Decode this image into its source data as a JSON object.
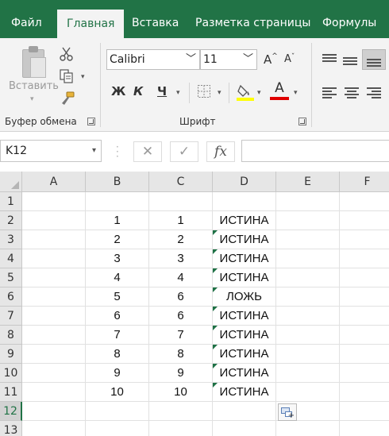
{
  "tabs": [
    {
      "label": "Файл",
      "active": false
    },
    {
      "label": "Главная",
      "active": true
    },
    {
      "label": "Вставка",
      "active": false
    },
    {
      "label": "Разметка страницы",
      "active": false
    },
    {
      "label": "Формулы",
      "active": false
    }
  ],
  "ribbon": {
    "clipboard": {
      "paste_label": "Вставить",
      "group_label": "Буфер обмена"
    },
    "font": {
      "font_name": "Calibri",
      "font_size": "11",
      "bold": "Ж",
      "italic": "К",
      "underline": "Ч",
      "grow": "A",
      "shrink": "A",
      "font_color_letter": "A",
      "group_label": "Шрифт"
    },
    "colors": {
      "accent": "#217346",
      "highlight": "#ffff00",
      "font_color": "#e00000"
    }
  },
  "formula_bar": {
    "name_box": "K12",
    "cancel": "✕",
    "enter": "✓",
    "fx": "fx",
    "value": ""
  },
  "grid": {
    "columns": [
      "A",
      "B",
      "C",
      "D",
      "E",
      "F"
    ],
    "rows": [
      {
        "num": "1",
        "cells": [
          "",
          "",
          "",
          "",
          "",
          ""
        ],
        "flag": false
      },
      {
        "num": "2",
        "cells": [
          "",
          "1",
          "1",
          "ИСТИНА",
          "",
          ""
        ],
        "flag": false
      },
      {
        "num": "3",
        "cells": [
          "",
          "2",
          "2",
          "ИСТИНА",
          "",
          ""
        ],
        "flag": true
      },
      {
        "num": "4",
        "cells": [
          "",
          "3",
          "3",
          "ИСТИНА",
          "",
          ""
        ],
        "flag": true
      },
      {
        "num": "5",
        "cells": [
          "",
          "4",
          "4",
          "ИСТИНА",
          "",
          ""
        ],
        "flag": true
      },
      {
        "num": "6",
        "cells": [
          "",
          "5",
          "6",
          "ЛОЖЬ",
          "",
          ""
        ],
        "flag": true
      },
      {
        "num": "7",
        "cells": [
          "",
          "6",
          "6",
          "ИСТИНА",
          "",
          ""
        ],
        "flag": true
      },
      {
        "num": "8",
        "cells": [
          "",
          "7",
          "7",
          "ИСТИНА",
          "",
          ""
        ],
        "flag": true
      },
      {
        "num": "9",
        "cells": [
          "",
          "8",
          "8",
          "ИСТИНА",
          "",
          ""
        ],
        "flag": true
      },
      {
        "num": "10",
        "cells": [
          "",
          "9",
          "9",
          "ИСТИНА",
          "",
          ""
        ],
        "flag": true
      },
      {
        "num": "11",
        "cells": [
          "",
          "10",
          "10",
          "ИСТИНА",
          "",
          ""
        ],
        "flag": true
      },
      {
        "num": "12",
        "cells": [
          "",
          "",
          "",
          "",
          "",
          ""
        ],
        "flag": false,
        "selected": true
      },
      {
        "num": "13",
        "cells": [
          "",
          "",
          "",
          "",
          "",
          ""
        ],
        "flag": false
      }
    ],
    "selected_row": "12",
    "error_flag_color": "#1e7145"
  }
}
